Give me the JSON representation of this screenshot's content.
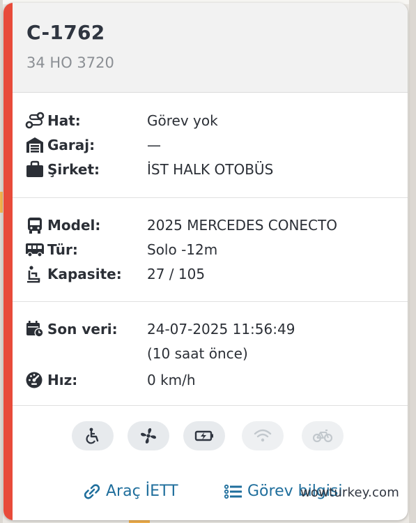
{
  "vehicle": {
    "code": "C-1762",
    "plate": "34 HO 3720"
  },
  "route_info": {
    "line_label": "Hat:",
    "line_value": "Görev yok",
    "garage_label": "Garaj:",
    "garage_value": "—",
    "company_label": "Şirket:",
    "company_value": "İST HALK OTOBÜS"
  },
  "specs": {
    "model_label": "Model:",
    "model_value": "2025 MERCEDES CONECTO",
    "type_label": "Tür:",
    "type_value": "Solo -12m",
    "capacity_label": "Kapasite:",
    "capacity_value": "27 / 105"
  },
  "status": {
    "last_data_label": "Son veri:",
    "last_data_value": "24-07-2025 11:56:49",
    "last_data_relative": "(10 saat önce)",
    "speed_label": "Hız:",
    "speed_value": "0 km/h"
  },
  "features": [
    {
      "icon": "wheelchair-icon",
      "active": true
    },
    {
      "icon": "air-conditioning-icon",
      "active": true
    },
    {
      "icon": "usb-charging-icon",
      "active": true
    },
    {
      "icon": "wifi-icon",
      "active": false
    },
    {
      "icon": "bicycle-icon",
      "active": false
    }
  ],
  "links": {
    "iett_label": "Araç İETT",
    "task_label": "Görev bilgisi"
  },
  "watermark": "wowturkey.com",
  "colors": {
    "accent_stripe": "#e84b3a",
    "link": "#1f6e9c",
    "text": "#2b2f36",
    "feature_active": "#2f3540",
    "feature_inactive": "#c2c8cd"
  }
}
